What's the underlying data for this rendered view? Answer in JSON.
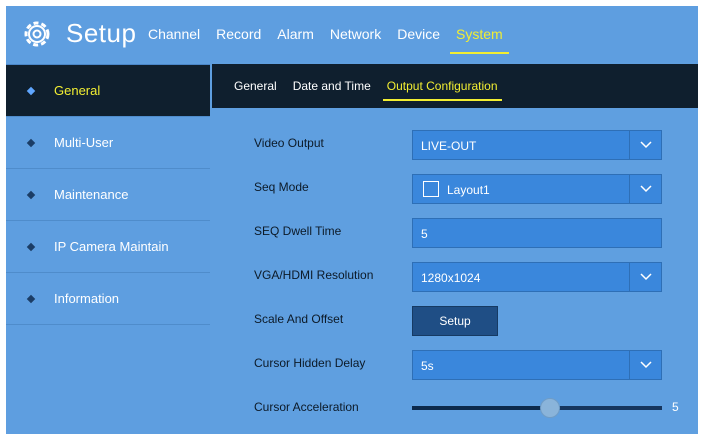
{
  "app": {
    "title": "Setup"
  },
  "top_tabs": [
    {
      "label": "Channel"
    },
    {
      "label": "Record"
    },
    {
      "label": "Alarm"
    },
    {
      "label": "Network"
    },
    {
      "label": "Device"
    },
    {
      "label": "System",
      "active": true
    }
  ],
  "sidebar": {
    "items": [
      {
        "label": "General",
        "active": true
      },
      {
        "label": "Multi-User"
      },
      {
        "label": "Maintenance"
      },
      {
        "label": "IP Camera Maintain"
      },
      {
        "label": "Information"
      }
    ]
  },
  "sub_tabs": [
    {
      "label": "General"
    },
    {
      "label": "Date and Time"
    },
    {
      "label": "Output Configuration",
      "active": true
    }
  ],
  "settings": {
    "video_output": {
      "label": "Video Output",
      "value": "LIVE-OUT"
    },
    "seq_mode": {
      "label": "Seq Mode",
      "value": "Layout1",
      "checked": false
    },
    "seq_dwell_time": {
      "label": "SEQ Dwell Time",
      "value": "5"
    },
    "resolution": {
      "label": "VGA/HDMI Resolution",
      "value": "1280x1024"
    },
    "scale_offset": {
      "label": "Scale And Offset",
      "button_label": "Setup"
    },
    "cursor_hidden_delay": {
      "label": "Cursor Hidden Delay",
      "value": "5s"
    },
    "cursor_acceleration": {
      "label": "Cursor Acceleration",
      "value": "5",
      "fraction": 0.55
    }
  },
  "colors": {
    "background": "#5f9fe0",
    "dark_panel": "#0f1f2e",
    "accent": "#f2ee32",
    "control": "#3a87dc"
  },
  "icons": {
    "logo": "gear-icon",
    "dropdown": "chevron-down-icon",
    "bullet": "diamond-bullet-icon"
  }
}
